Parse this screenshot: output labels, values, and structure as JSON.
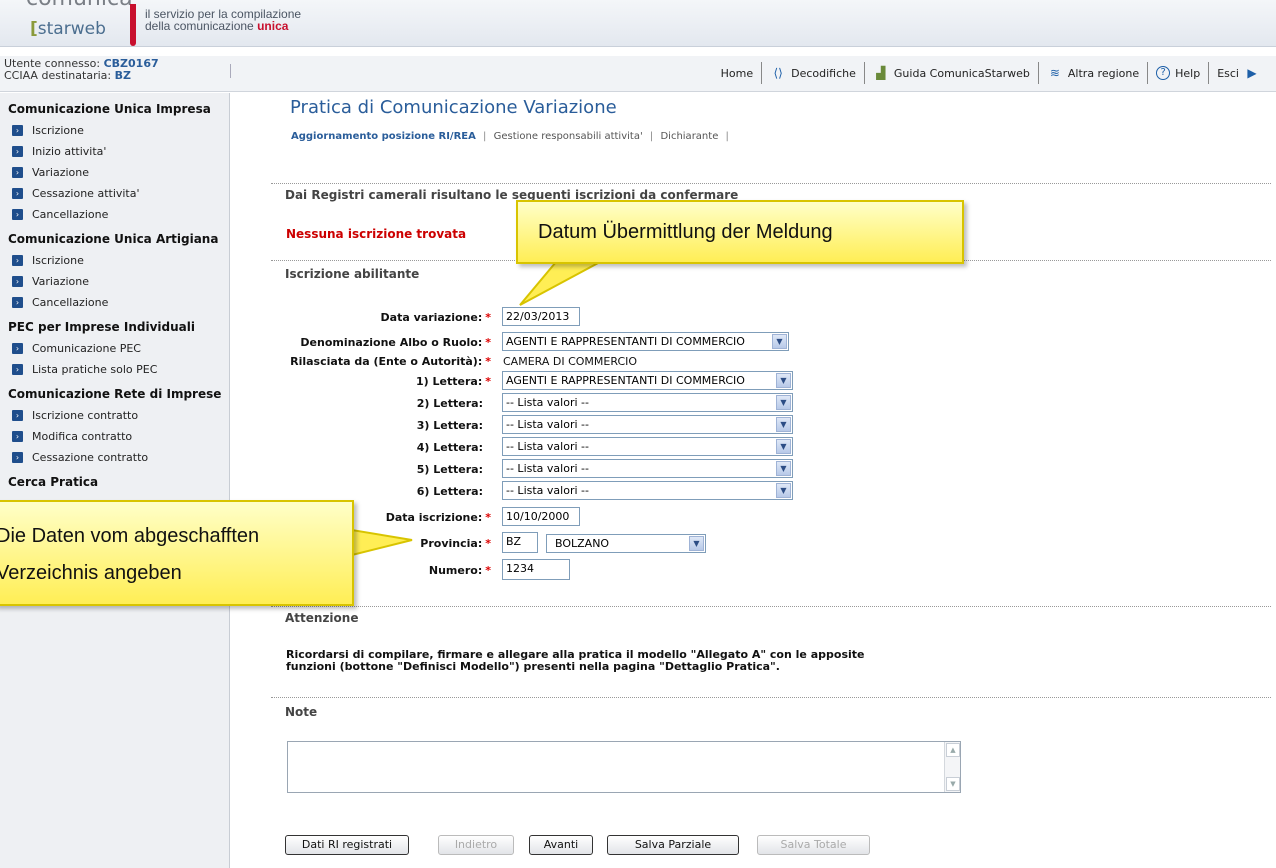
{
  "header": {
    "logo_top": "comunica",
    "logo_brand": "starweb",
    "logo_bracket": "[",
    "tagline_line1": "il servizio per la compilazione",
    "tagline_line2_prefix": "della comunicazione ",
    "tagline_line2_accent": "unica"
  },
  "topbar": {
    "user_label": "Utente connesso: ",
    "user_value": "CBZ0167",
    "cciaa_label": "CCIAA destinataria: ",
    "cciaa_value": "BZ",
    "nav": {
      "home": "Home",
      "decodifiche": "Decodifiche",
      "guida": "Guida ComunicaStarweb",
      "altra_regione": "Altra regione",
      "help": "Help",
      "esci": "Esci"
    }
  },
  "sidebar": {
    "sections": [
      {
        "title": "Comunicazione Unica Impresa",
        "items": [
          "Iscrizione",
          "Inizio attivita'",
          "Variazione",
          "Cessazione attivita'",
          "Cancellazione"
        ]
      },
      {
        "title": "Comunicazione Unica Artigiana",
        "items": [
          "Iscrizione",
          "Variazione",
          "Cancellazione"
        ]
      },
      {
        "title": "PEC per Imprese Individuali",
        "items": [
          "Comunicazione PEC",
          "Lista pratiche solo PEC"
        ]
      },
      {
        "title": "Comunicazione Rete di Imprese",
        "items": [
          "Iscrizione contratto",
          "Modifica contratto",
          "Cessazione contratto"
        ]
      },
      {
        "title": "Cerca Pratica",
        "items": []
      }
    ]
  },
  "main": {
    "title": "Pratica di Comunicazione Variazione",
    "subnav": {
      "active": "Aggiornamento posizione RI/REA",
      "item2": "Gestione responsabili attivita'",
      "item3": "Dichiarante",
      "sep": "|"
    },
    "registri_heading": "Dai Registri camerali risultano le seguenti iscrizioni da confermare",
    "no_results": "Nessuna iscrizione trovata",
    "iscrizione_heading": "Iscrizione abilitante",
    "form": {
      "data_variazione_label": "Data variazione:",
      "data_variazione_value": "22/03/2013",
      "denominazione_label": "Denominazione Albo o Ruolo:",
      "denominazione_value": "AGENTI E RAPPRESENTANTI DI COMMERCIO",
      "rilasciata_label": "Rilasciata da (Ente o Autorità):",
      "rilasciata_value": "CAMERA DI COMMERCIO",
      "lettera1_label": "1) Lettera:",
      "lettera1_value": "AGENTI E RAPPRESENTANTI DI COMMERCIO",
      "lettera2_label": "2) Lettera:",
      "lettera3_label": "3) Lettera:",
      "lettera4_label": "4) Lettera:",
      "lettera5_label": "5) Lettera:",
      "lettera6_label": "6) Lettera:",
      "lista_valori": "-- Lista valori --",
      "data_iscrizione_label": "Data iscrizione:",
      "data_iscrizione_value": "10/10/2000",
      "provincia_label": "Provincia:",
      "provincia_code": "BZ",
      "provincia_name": "BOLZANO",
      "numero_label": "Numero:",
      "numero_value": "1234",
      "required_mark": "*"
    },
    "attenzione_heading": "Attenzione",
    "attenzione_line1": "Ricordarsi di compilare, firmare e allegare alla pratica il modello \"Allegato A\" con le apposite",
    "attenzione_line2": "funzioni (bottone \"Definisci Modello\") presenti nella pagina \"Dettaglio Pratica\".",
    "note_heading": "Note",
    "note_value": "",
    "buttons": {
      "dati_ri": "Dati RI registrati",
      "indietro": "Indietro",
      "avanti": "Avanti",
      "salva_parziale": "Salva Parziale",
      "salva_totale": "Salva Totale"
    }
  },
  "callouts": {
    "datum": "Datum Übermittlung der Meldung",
    "daten_line1": "Die Daten vom abgeschafften",
    "daten_line2": "Verzeichnis angeben"
  },
  "colors": {
    "brand_blue": "#2a5d9a",
    "brand_red": "#c8102e",
    "callout_yellow": "#ffee55",
    "error_red": "#cc0000"
  }
}
